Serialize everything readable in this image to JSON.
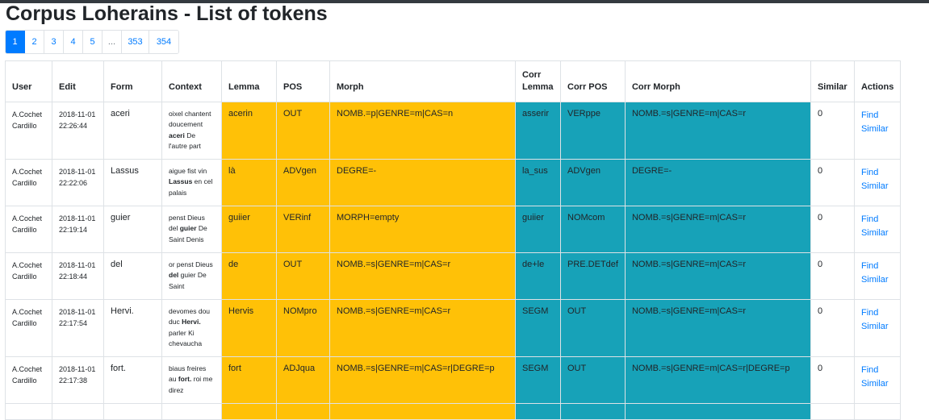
{
  "page": {
    "title": "Corpus Loherains - List of tokens"
  },
  "pagination": {
    "items": [
      {
        "label": "1",
        "active": true
      },
      {
        "label": "2"
      },
      {
        "label": "3"
      },
      {
        "label": "4"
      },
      {
        "label": "5"
      },
      {
        "label": "...",
        "disabled": true
      },
      {
        "label": "353"
      },
      {
        "label": "354"
      }
    ]
  },
  "table": {
    "headers": [
      "User",
      "Edit",
      "Form",
      "Context",
      "Lemma",
      "POS",
      "Morph",
      "Corr Lemma",
      "Corr POS",
      "Corr Morph",
      "Similar",
      "Actions"
    ],
    "action_find": "Find",
    "action_similar": "Similar",
    "rows": [
      {
        "user": [
          "A.Cochet",
          "Cardillo"
        ],
        "edit": [
          "2018-11-01",
          "22:26:44"
        ],
        "form": "aceri",
        "context": {
          "before": "oixel chantent doucement",
          "token": "aceri",
          "after": "De l'autre part"
        },
        "lemma": "acerin",
        "pos": "OUT",
        "morph": "NOMB.=p|GENRE=m|CAS=n",
        "corr_lemma": "asserir",
        "corr_pos": "VERppe",
        "corr_morph": "NOMB.=s|GENRE=m|CAS=r",
        "similar": "0"
      },
      {
        "user": [
          "A.Cochet",
          "Cardillo"
        ],
        "edit": [
          "2018-11-01",
          "22:22:06"
        ],
        "form": "Lassus",
        "context": {
          "before": "aigue fist vin",
          "token": "Lassus",
          "after": "en cel palais"
        },
        "lemma": "là",
        "pos": "ADVgen",
        "morph": "DEGRE=-",
        "corr_lemma": "la_sus",
        "corr_pos": "ADVgen",
        "corr_morph": "DEGRE=-",
        "similar": "0"
      },
      {
        "user": [
          "A.Cochet",
          "Cardillo"
        ],
        "edit": [
          "2018-11-01",
          "22:19:14"
        ],
        "form": "guier",
        "context": {
          "before": "penst Dieus del",
          "token": "guier",
          "after": "De Saint Denis"
        },
        "lemma": "guiier",
        "pos": "VERinf",
        "morph": "MORPH=empty",
        "corr_lemma": "guiier",
        "corr_pos": "NOMcom",
        "corr_morph": "NOMB.=s|GENRE=m|CAS=r",
        "similar": "0"
      },
      {
        "user": [
          "A.Cochet",
          "Cardillo"
        ],
        "edit": [
          "2018-11-01",
          "22:18:44"
        ],
        "form": "del",
        "context": {
          "before": "or penst Dieus",
          "token": "del",
          "after": "guier De Saint"
        },
        "lemma": "de",
        "pos": "OUT",
        "morph": "NOMB.=s|GENRE=m|CAS=r",
        "corr_lemma": "de+le",
        "corr_pos": "PRE.DETdef",
        "corr_morph": "NOMB.=s|GENRE=m|CAS=r",
        "similar": "0"
      },
      {
        "user": [
          "A.Cochet",
          "Cardillo"
        ],
        "edit": [
          "2018-11-01",
          "22:17:54"
        ],
        "form": "Hervi.",
        "context": {
          "before": "devomes dou duc",
          "token": "Hervi.",
          "after": "parler Ki chevaucha"
        },
        "lemma": "Hervis",
        "pos": "NOMpro",
        "morph": "NOMB.=s|GENRE=m|CAS=r",
        "corr_lemma": "SEGM",
        "corr_pos": "OUT",
        "corr_morph": "NOMB.=s|GENRE=m|CAS=r",
        "similar": "0"
      },
      {
        "user": [
          "A.Cochet",
          "Cardillo"
        ],
        "edit": [
          "2018-11-01",
          "22:17:38"
        ],
        "form": "fort.",
        "context": {
          "before": "biaus freires au",
          "token": "fort.",
          "after": "roi me direz"
        },
        "lemma": "fort",
        "pos": "ADJqua",
        "morph": "NOMB.=s|GENRE=m|CAS=r|DEGRE=p",
        "corr_lemma": "SEGM",
        "corr_pos": "OUT",
        "corr_morph": "NOMB.=s|GENRE=m|CAS=r|DEGRE=p",
        "similar": "0"
      }
    ]
  },
  "colors": {
    "lemma_bg": "#ffc107",
    "corr_bg": "#17a2b8",
    "active_page": "#007bff",
    "link": "#007bff"
  }
}
